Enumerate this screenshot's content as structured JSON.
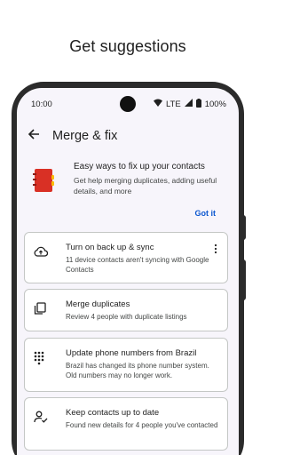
{
  "caption": "Get suggestions",
  "status_bar": {
    "time": "10:00",
    "network": "LTE",
    "battery": "100%"
  },
  "app_bar": {
    "title": "Merge & fix"
  },
  "promo": {
    "title": "Easy ways to fix up your contacts",
    "body": "Get help merging duplicates, adding useful details, and more",
    "action": "Got it"
  },
  "cards": [
    {
      "icon": "cloud-upload-icon",
      "title": "Turn on back up & sync",
      "body": "11 device contacts aren't syncing with Google Contacts"
    },
    {
      "icon": "merge-duplicates-icon",
      "title": "Merge duplicates",
      "body": "Review 4 people with duplicate listings"
    },
    {
      "icon": "dialpad-icon",
      "title": "Update phone numbers from Brazil",
      "body": "Brazil has changed its phone number system. Old numbers may no longer work."
    },
    {
      "icon": "person-check-icon",
      "title": "Keep contacts up to date",
      "body": "Found new details for 4 people you've contacted"
    }
  ],
  "colors": {
    "accent": "#0b57d0",
    "screen_bg": "#f7f5fb",
    "card_border": "#c4c7c5",
    "phone_frame": "#2b2b2b",
    "illustration_red": "#d93025"
  }
}
